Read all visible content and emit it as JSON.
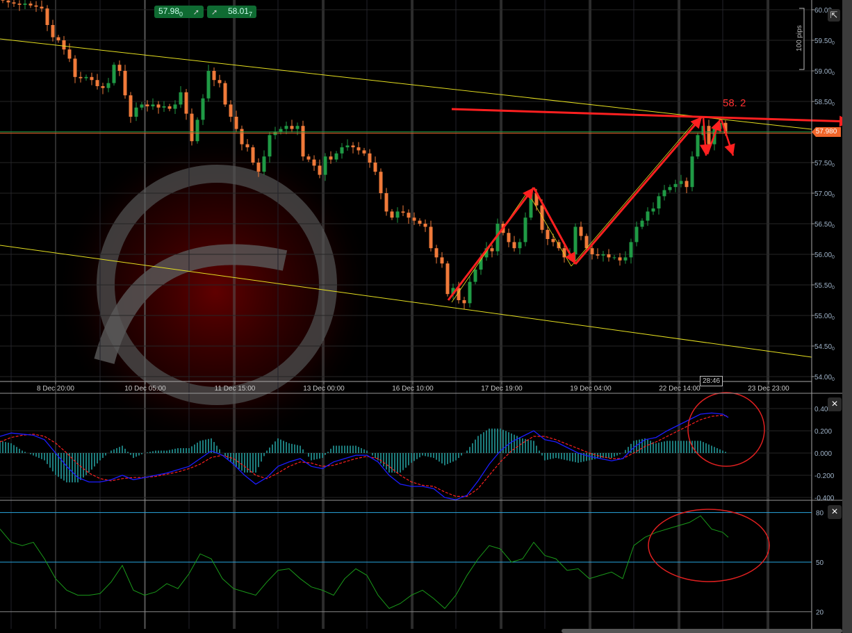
{
  "toolbar": {
    "sell": {
      "price": "57.98",
      "pipette": "0",
      "icon": "arrow-up-right-icon"
    },
    "buy": {
      "price": "58.01",
      "pipette": "7",
      "icon": "arrow-up-right-icon"
    },
    "popout_icon": "external-window-icon",
    "close_icon": "×"
  },
  "colors": {
    "up": "#1f9a45",
    "down": "#f07a3a",
    "trend": "#e6e020",
    "annotation": "#ff2020",
    "macd": "#1c1cff",
    "signal": "#ff2020",
    "histogram": "#30d0d0",
    "rsi": "#1a9a1a",
    "levels": "#29a8e0",
    "current_price": "#f0652a"
  },
  "chart_data": [
    {
      "type": "candlestick",
      "price_axis": {
        "ticks": [
          "60.00",
          "59.50",
          "59.00",
          "58.50",
          "58.00",
          "57.50",
          "57.00",
          "56.50",
          "56.00",
          "55.50",
          "55.00",
          "54.50",
          "54.00"
        ],
        "pipette": "0",
        "ylim": [
          54.0,
          60.0
        ]
      },
      "time_axis": {
        "ticks": [
          "8 Dec 20:00",
          "10 Dec 05:00",
          "11 Dec 15:00",
          "13 Dec 00:00",
          "16 Dec 10:00",
          "17 Dec 19:00",
          "19 Dec 04:00",
          "22 Dec 14:00",
          "23 Dec 23:00"
        ]
      },
      "current_price": "57.980",
      "countdown": "28:46",
      "annotations": {
        "level_label": "58. 2",
        "range_label": "100 pips"
      },
      "closes": [
        60.15,
        60.12,
        60.1,
        60.08,
        60.1,
        60.07,
        60.05,
        60.02,
        59.75,
        59.55,
        59.5,
        59.35,
        59.2,
        58.9,
        58.88,
        58.9,
        58.85,
        58.75,
        58.72,
        58.8,
        59.1,
        59.0,
        58.6,
        58.25,
        58.4,
        58.45,
        58.42,
        58.45,
        58.4,
        58.42,
        58.38,
        58.45,
        58.65,
        58.3,
        57.85,
        58.2,
        58.55,
        59.0,
        58.85,
        58.8,
        58.45,
        58.25,
        58.05,
        57.8,
        57.75,
        57.5,
        57.35,
        57.6,
        57.95,
        58.0,
        58.05,
        58.1,
        58.05,
        58.1,
        57.6,
        57.55,
        57.45,
        57.3,
        57.6,
        57.55,
        57.65,
        57.75,
        57.78,
        57.75,
        57.7,
        57.65,
        57.5,
        57.35,
        57.0,
        56.7,
        56.6,
        56.7,
        56.68,
        56.6,
        56.55,
        56.5,
        56.45,
        56.1,
        55.95,
        55.85,
        55.35,
        55.45,
        55.25,
        55.2,
        55.55,
        55.75,
        55.95,
        56.1,
        56.05,
        56.5,
        56.35,
        56.2,
        56.1,
        56.2,
        56.6,
        57.0,
        56.8,
        56.4,
        56.25,
        56.2,
        56.1,
        55.95,
        56.0,
        56.45,
        56.3,
        56.1,
        56.0,
        55.98,
        56.0,
        55.95,
        55.95,
        55.9,
        55.95,
        56.2,
        56.45,
        56.55,
        56.7,
        56.75,
        56.95,
        57.05,
        57.1,
        57.15,
        57.2,
        57.1,
        57.6,
        57.95,
        58.1,
        57.8,
        58.05,
        58.15,
        57.98
      ]
    },
    {
      "type": "line",
      "axis_ticks": [
        "0.400",
        "0.200",
        "0.000",
        "-0.200",
        "-0.400"
      ],
      "ylim": [
        -0.44,
        0.5
      ],
      "series": [
        {
          "role": "line",
          "values": [
            0.15,
            0.18,
            0.17,
            0.16,
            0.12,
            0.0,
            -0.12,
            -0.22,
            -0.26,
            -0.26,
            -0.24,
            -0.2,
            -0.24,
            -0.22,
            -0.2,
            -0.18,
            -0.15,
            -0.12,
            -0.05,
            0.02,
            -0.02,
            -0.1,
            -0.2,
            -0.28,
            -0.22,
            -0.12,
            -0.08,
            -0.05,
            -0.12,
            -0.14,
            -0.08,
            -0.05,
            -0.02,
            -0.02,
            -0.08,
            -0.2,
            -0.28,
            -0.3,
            -0.3,
            -0.32,
            -0.4,
            -0.42,
            -0.38,
            -0.25,
            -0.1,
            0.02,
            0.1,
            0.15,
            0.2,
            0.12,
            0.1,
            0.05,
            0.0,
            -0.03,
            -0.05,
            -0.07,
            -0.05,
            0.05,
            0.12,
            0.14,
            0.2,
            0.25,
            0.3,
            0.35,
            0.36,
            0.35,
            0.32
          ]
        },
        {
          "role": "signal",
          "values": [
            0.1,
            0.14,
            0.16,
            0.17,
            0.15,
            0.09,
            0.0,
            -0.1,
            -0.18,
            -0.23,
            -0.25,
            -0.23,
            -0.22,
            -0.22,
            -0.21,
            -0.19,
            -0.17,
            -0.14,
            -0.1,
            -0.04,
            -0.02,
            -0.05,
            -0.12,
            -0.2,
            -0.23,
            -0.18,
            -0.12,
            -0.08,
            -0.09,
            -0.12,
            -0.11,
            -0.08,
            -0.05,
            -0.03,
            -0.05,
            -0.12,
            -0.2,
            -0.26,
            -0.29,
            -0.3,
            -0.35,
            -0.39,
            -0.39,
            -0.32,
            -0.2,
            -0.08,
            0.02,
            0.09,
            0.15,
            0.15,
            0.12,
            0.08,
            0.04,
            0.0,
            -0.03,
            -0.05,
            -0.05,
            0.0,
            0.06,
            0.1,
            0.15,
            0.2,
            0.25,
            0.3,
            0.33,
            0.34,
            0.33
          ]
        }
      ]
    },
    {
      "type": "line",
      "axis_ticks": [
        "80",
        "50",
        "20"
      ],
      "levels": [
        80,
        50,
        20
      ],
      "ylim": [
        9,
        87
      ],
      "values": [
        70,
        62,
        60,
        62,
        52,
        40,
        33,
        30,
        30,
        31,
        38,
        48,
        33,
        30,
        32,
        37,
        34,
        43,
        55,
        52,
        40,
        34,
        32,
        30,
        38,
        45,
        46,
        40,
        35,
        33,
        30,
        40,
        46,
        42,
        30,
        22,
        25,
        30,
        33,
        28,
        22,
        30,
        42,
        52,
        60,
        58,
        50,
        52,
        62,
        54,
        52,
        45,
        46,
        40,
        42,
        44,
        40,
        60,
        65,
        68,
        70,
        72,
        74,
        78,
        70,
        68,
        65
      ]
    }
  ]
}
